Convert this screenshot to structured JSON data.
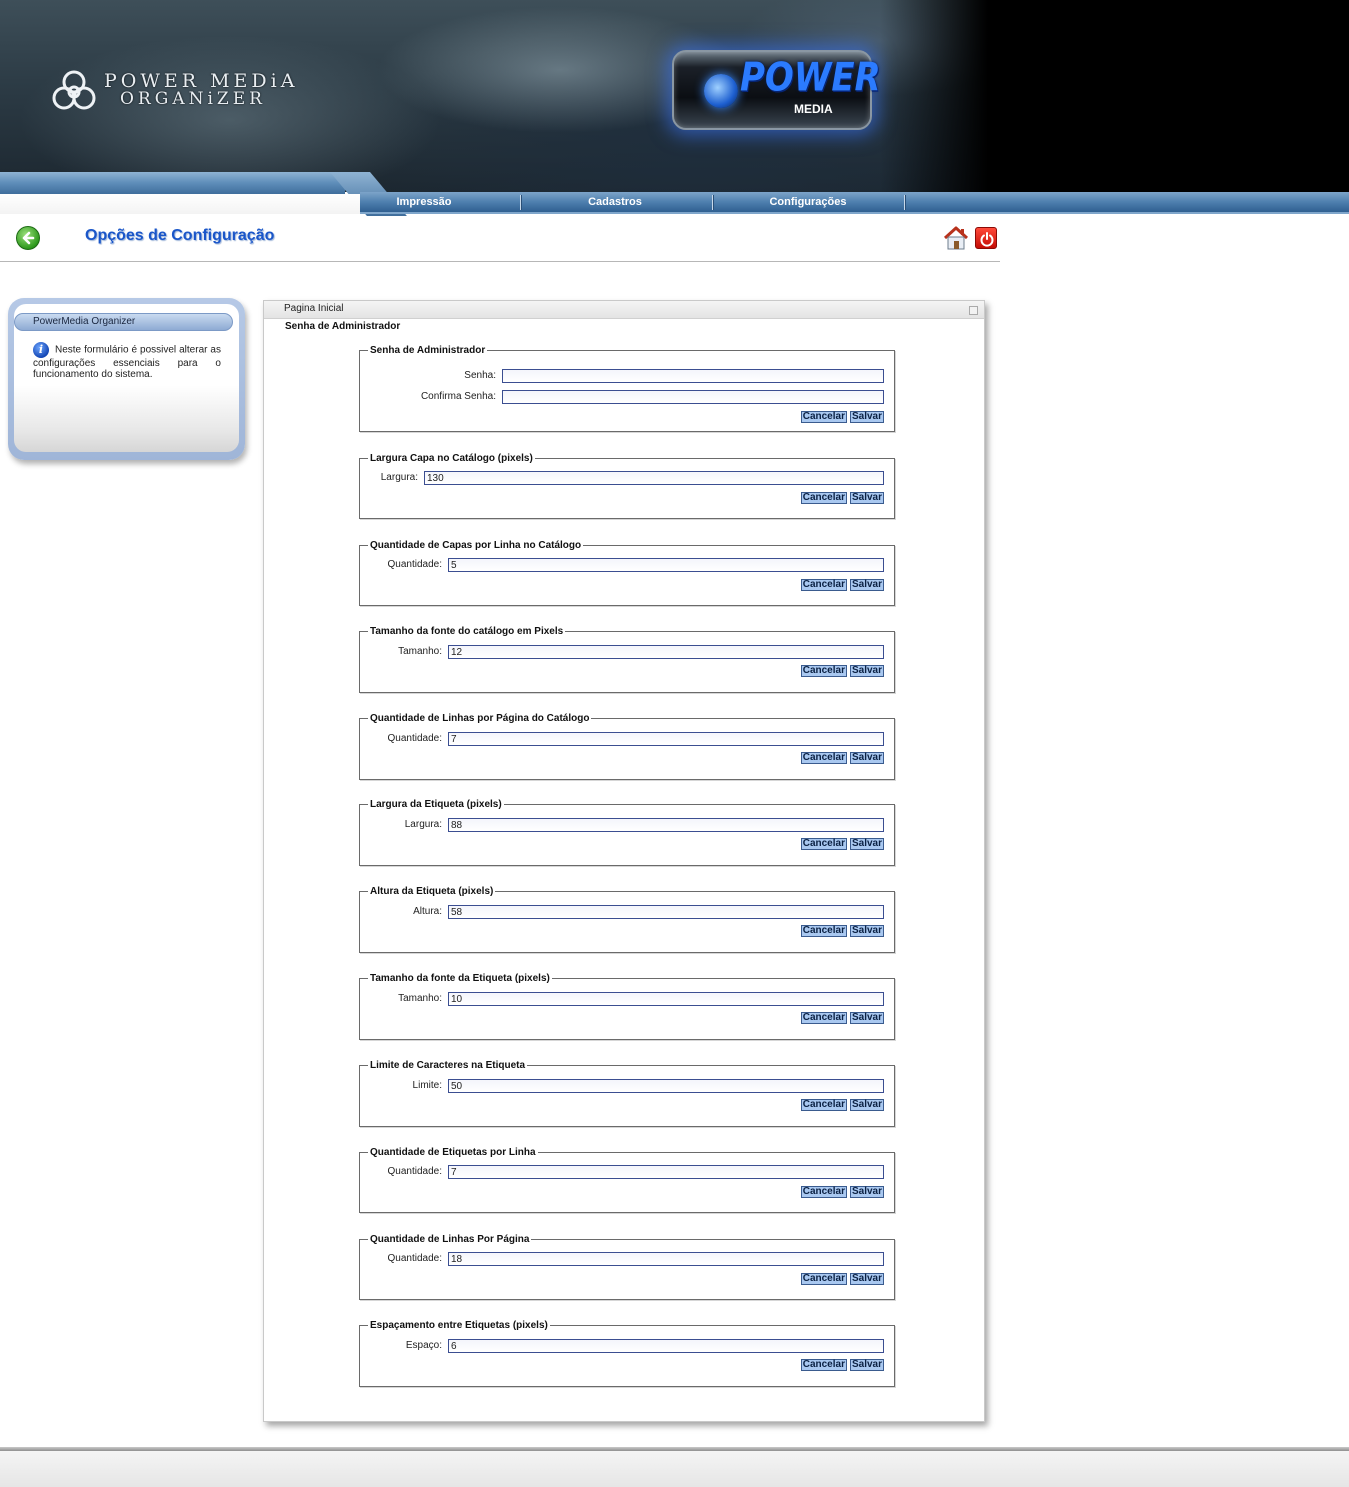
{
  "header": {
    "logo_line1": "POWER MEDiA",
    "logo_line2": "ORGANiZER",
    "banner_title": "POWER",
    "banner_subtitle": "MEDIA"
  },
  "nav": {
    "items": [
      {
        "label": "Impressão"
      },
      {
        "label": "Cadastros"
      },
      {
        "label": "Configurações"
      }
    ]
  },
  "page": {
    "title": "Opções de Configuração"
  },
  "sidebar": {
    "header": "PowerMedia Organizer",
    "info_text": "Neste formulário é possivel alterar as configurações essenciais para o funcionamento do sistema."
  },
  "main": {
    "tab_label": "Pagina Inicial",
    "section_title": "Senha de Administrador",
    "cancel_label": "Cancelar",
    "save_label": "Salvar",
    "groups": [
      {
        "legend": "Senha de Administrador",
        "fields": [
          {
            "label": "Senha:",
            "value": ""
          },
          {
            "label": "Confirma Senha:",
            "value": ""
          }
        ]
      },
      {
        "legend": "Largura Capa no Catálogo (pixels)",
        "fields": [
          {
            "label": "Largura:",
            "value": "130"
          }
        ]
      },
      {
        "legend": "Quantidade de Capas por Linha no Catálogo",
        "fields": [
          {
            "label": "Quantidade:",
            "value": "5"
          }
        ]
      },
      {
        "legend": "Tamanho da fonte do catálogo em Pixels",
        "fields": [
          {
            "label": "Tamanho:",
            "value": "12"
          }
        ]
      },
      {
        "legend": "Quantidade de Linhas por Página do Catálogo",
        "fields": [
          {
            "label": "Quantidade:",
            "value": "7"
          }
        ]
      },
      {
        "legend": "Largura da Etiqueta (pixels)",
        "fields": [
          {
            "label": "Largura:",
            "value": "88"
          }
        ]
      },
      {
        "legend": "Altura da Etiqueta (pixels)",
        "fields": [
          {
            "label": "Altura:",
            "value": "58"
          }
        ]
      },
      {
        "legend": "Tamanho da fonte da Etiqueta (pixels)",
        "fields": [
          {
            "label": "Tamanho:",
            "value": "10"
          }
        ]
      },
      {
        "legend": "Limite de Caracteres na Etiqueta",
        "fields": [
          {
            "label": "Limite:",
            "value": "50"
          }
        ]
      },
      {
        "legend": "Quantidade de Etiquetas por Linha",
        "fields": [
          {
            "label": "Quantidade:",
            "value": "7"
          }
        ]
      },
      {
        "legend": "Quantidade de Linhas Por Página",
        "fields": [
          {
            "label": "Quantidade:",
            "value": "18"
          }
        ]
      },
      {
        "legend": "Espaçamento entre Etiquetas (pixels)",
        "fields": [
          {
            "label": "Espaço:",
            "value": "6"
          }
        ]
      }
    ]
  }
}
